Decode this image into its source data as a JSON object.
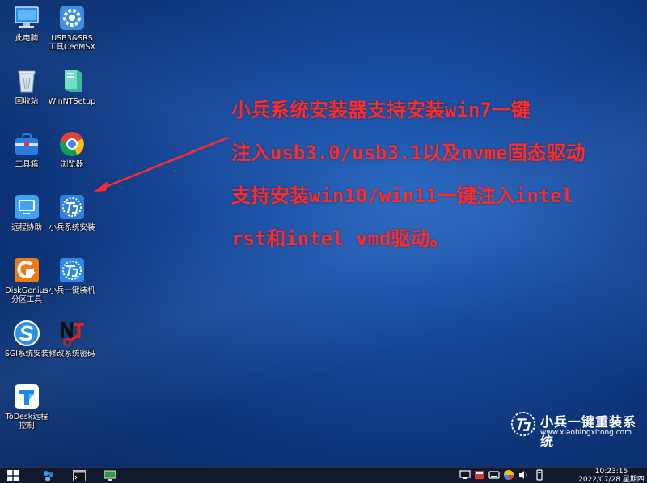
{
  "desktop": {
    "icons": [
      {
        "label": "此电脑",
        "icon": "computer-icon"
      },
      {
        "label": "USB3&SRS\n工具CeoMSX",
        "icon": "gear-icon"
      },
      {
        "label": "回收站",
        "icon": "recycle-bin-icon"
      },
      {
        "label": "WinNTSetup",
        "icon": "winntsetup-icon"
      },
      {
        "label": "工具箱",
        "icon": "toolbox-icon"
      },
      {
        "label": "浏览器",
        "icon": "chrome-icon"
      },
      {
        "label": "远程协助",
        "icon": "remote-assist-icon"
      },
      {
        "label": "小兵系统安装",
        "icon": "xiaobing-installer-icon"
      },
      {
        "label": "DiskGenius\n分区工具",
        "icon": "diskgenius-icon"
      },
      {
        "label": "小兵一键装机",
        "icon": "xiaobing-onekey-icon"
      },
      {
        "label": "SGI系统安装",
        "icon": "sgi-icon"
      },
      {
        "label": "修改系统密码",
        "icon": "nt-password-icon"
      },
      {
        "label": "ToDesk远程\n控制",
        "icon": "todesk-icon"
      }
    ]
  },
  "annotation": {
    "lines": [
      "小兵系统安装器支持安装win7一键",
      "注入usb3.0/usb3.1以及nvme固态驱动",
      "支持安装win10/win11一键注入intel",
      "rst和intel vmd驱动。"
    ],
    "color": "#ff2a2a"
  },
  "watermark": {
    "title": "小兵一键重装系统",
    "url": "www.xiaobingxitong.com"
  },
  "taskbar": {
    "time": "10:23:15",
    "date": "2022/07/28 星期四"
  }
}
